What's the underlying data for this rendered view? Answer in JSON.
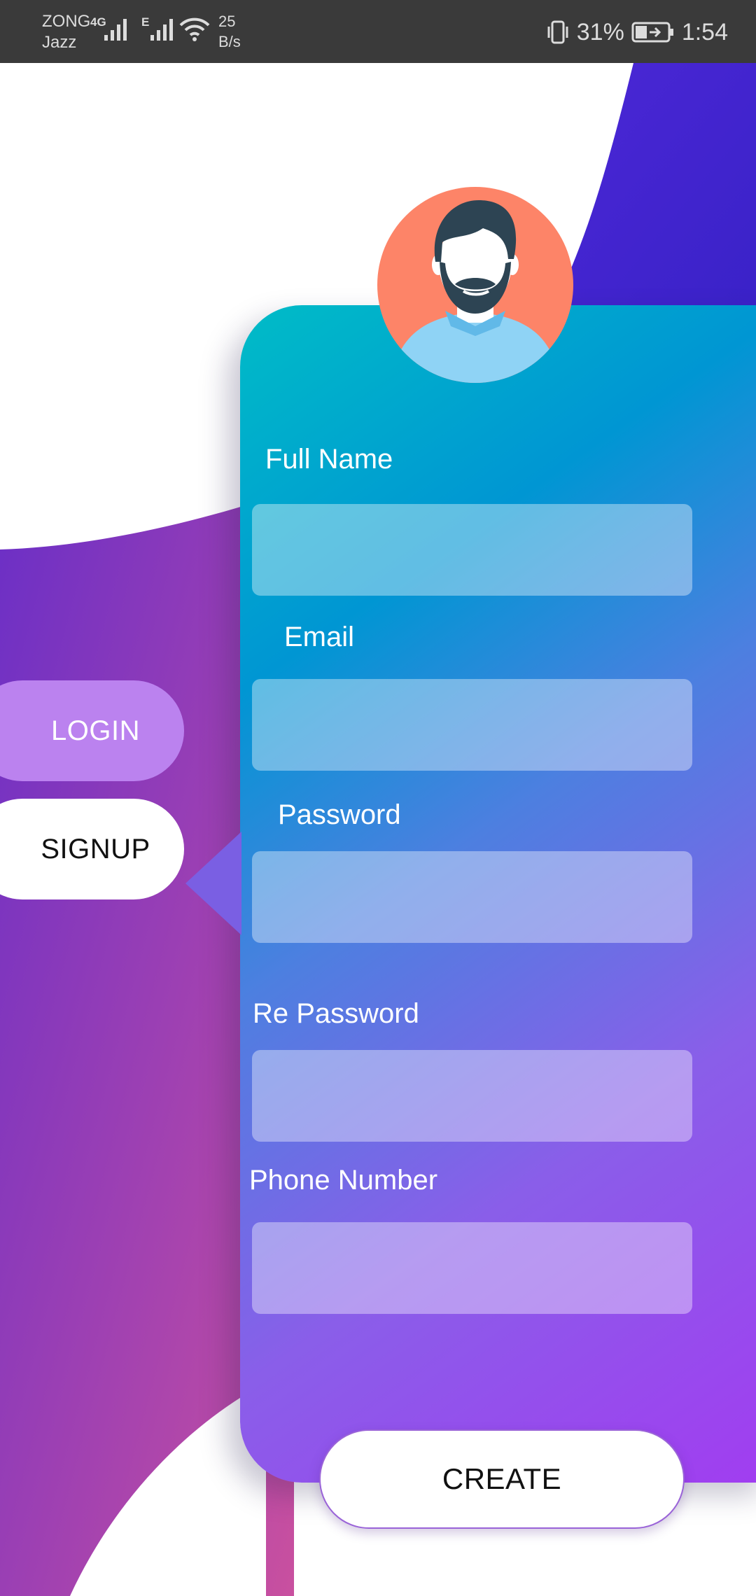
{
  "status_bar": {
    "carrier_1": "ZONG",
    "carrier_2": "Jazz",
    "network_1": "4G",
    "network_2": "E",
    "speed_value": "25",
    "speed_unit": "B/s",
    "battery": "31%",
    "time": "1:54"
  },
  "tabs": {
    "login": "LOGIN",
    "signup": "SIGNUP"
  },
  "form": {
    "full_name_label": "Full Name",
    "email_label": "Email",
    "password_label": "Password",
    "re_password_label": "Re Password",
    "phone_label": "Phone Number",
    "full_name_value": "",
    "email_value": "",
    "password_value": "",
    "re_password_value": "",
    "phone_value": ""
  },
  "create_label": "CREATE",
  "colors": {
    "gradient_top": "#00bcc7",
    "gradient_bottom": "#a13df0",
    "purple_bg": "#7b2fc4",
    "login_tab": "#bb82ef",
    "avatar_bg": "#fd8468"
  }
}
